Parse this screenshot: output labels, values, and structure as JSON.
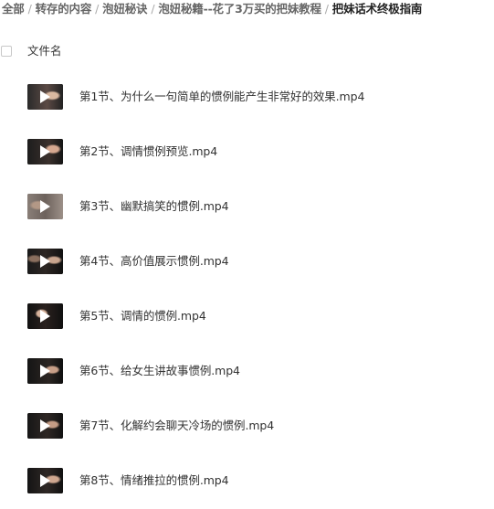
{
  "breadcrumb": {
    "items": [
      "全部",
      "转存的内容",
      "泡妞秘诀",
      "泡妞秘籍--花了3万买的把妹教程",
      "把妹话术终极指南"
    ],
    "separator": "/"
  },
  "list_header": {
    "column_name": "文件名"
  },
  "files": [
    {
      "name": "第1节、为什么一句简单的惯例能产生非常好的效果.mp4",
      "icon": "video-thumbnail-icon"
    },
    {
      "name": "第2节、调情惯例预览.mp4",
      "icon": "video-thumbnail-icon"
    },
    {
      "name": "第3节、幽默搞笑的惯例.mp4",
      "icon": "video-thumbnail-icon"
    },
    {
      "name": "第4节、高价值展示惯例.mp4",
      "icon": "video-thumbnail-icon"
    },
    {
      "name": "第5节、调情的惯例.mp4",
      "icon": "video-thumbnail-icon"
    },
    {
      "name": "第6节、给女生讲故事惯例.mp4",
      "icon": "video-thumbnail-icon"
    },
    {
      "name": "第7节、化解约会聊天冷场的惯例.mp4",
      "icon": "video-thumbnail-icon"
    },
    {
      "name": "第8节、情绪推拉的惯例.mp4",
      "icon": "video-thumbnail-icon"
    }
  ],
  "colors": {
    "breadcrumb_text": "#666666",
    "breadcrumb_current": "#222222",
    "file_text": "#333333",
    "thumbnail_bg": "#1a1a1a"
  }
}
